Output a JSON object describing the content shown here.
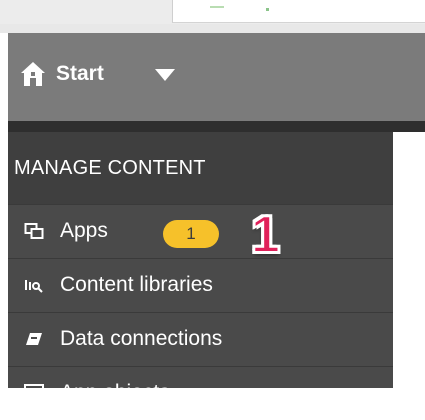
{
  "header": {
    "start_label": "Start",
    "icons": [
      "home-icon",
      "caret-down-icon"
    ],
    "background": "#7b7b7b"
  },
  "sidebar": {
    "section_title": "MANAGE CONTENT",
    "items": [
      {
        "label": "Apps",
        "icon": "apps-icon",
        "badge": "1"
      },
      {
        "label": "Content libraries",
        "icon": "content-libraries-icon"
      },
      {
        "label": "Data connections",
        "icon": "data-connections-icon"
      },
      {
        "label": "App objects",
        "icon": "app-objects-icon"
      }
    ]
  },
  "annotation": {
    "number": "1",
    "color": "#e0215a"
  },
  "colors": {
    "badge": "#f6c12a",
    "sidebar_bg": "#4a4a4a"
  }
}
